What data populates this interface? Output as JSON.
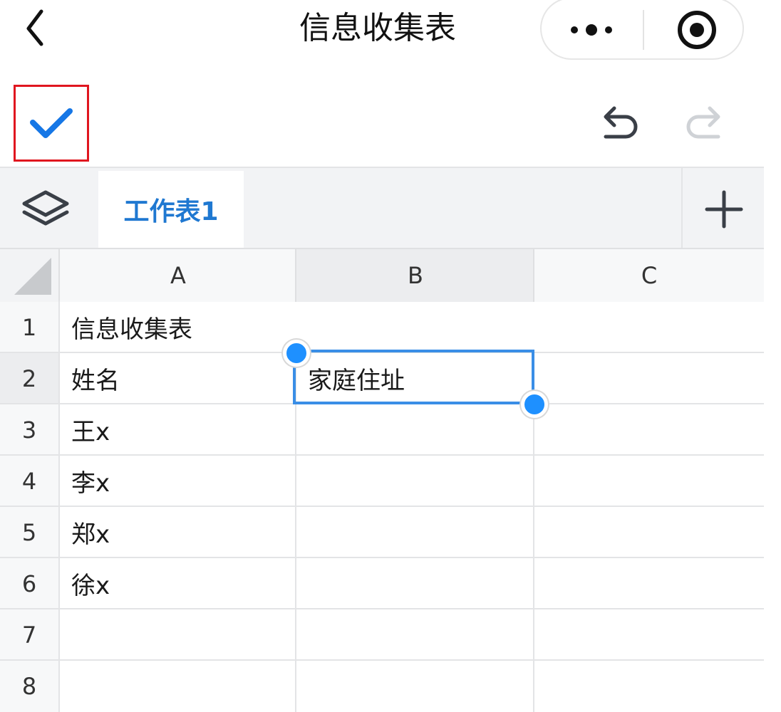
{
  "header": {
    "title": "信息收集表"
  },
  "tabs": {
    "sheets": [
      {
        "label": "工作表1",
        "active": true
      }
    ]
  },
  "grid": {
    "columns": [
      "A",
      "B",
      "C"
    ],
    "rows": [
      "1",
      "2",
      "3",
      "4",
      "5",
      "6",
      "7",
      "8"
    ],
    "cells": {
      "A1": "信息收集表",
      "A2": "姓名",
      "B2": "家庭住址",
      "A3": "王x",
      "A4": "李x",
      "A5": "郑x",
      "A6": "徐x"
    },
    "selected_cell": "B2"
  },
  "colors": {
    "accent": "#1f78d1",
    "selection": "#3a8ee6",
    "handle": "#1e90ff",
    "highlight_box": "#e0161f"
  },
  "icons": {
    "back": "chevron-left-icon",
    "more": "more-dots-icon",
    "close_target": "target-icon",
    "confirm": "check-icon",
    "undo": "undo-icon",
    "redo": "redo-icon",
    "layers": "layers-icon",
    "add_sheet": "plus-icon"
  }
}
